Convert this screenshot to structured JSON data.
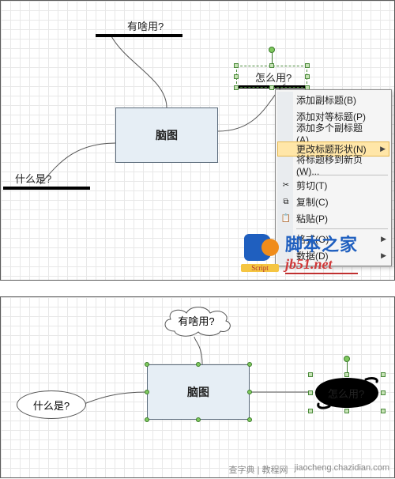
{
  "top": {
    "center": "脑图",
    "branch_top": "有啥用?",
    "branch_right": "怎么用?",
    "branch_left": "什么是?"
  },
  "menu": {
    "add_sub": "添加副标题(B)",
    "add_peer": "添加对等标题(P)",
    "add_multi": "添加多个副标题(A)...",
    "change_shape": "更改标题形状(N)",
    "move_new": "将标题移到新页(W)...",
    "cut": "剪切(T)",
    "copy": "复制(C)",
    "paste": "粘贴(P)",
    "format": "格式(O)",
    "data": "数据(D)"
  },
  "watermark": {
    "script": "Script",
    "cn": "脚本之家",
    "en": "jb51.net"
  },
  "bottom": {
    "center": "脑图",
    "branch_top": "有啥用?",
    "branch_right": "怎么用?",
    "branch_left": "什么是?"
  },
  "footer": {
    "site_cn": "查字典 | 教程网",
    "site_en": "jiaocheng.chazidian.com"
  }
}
